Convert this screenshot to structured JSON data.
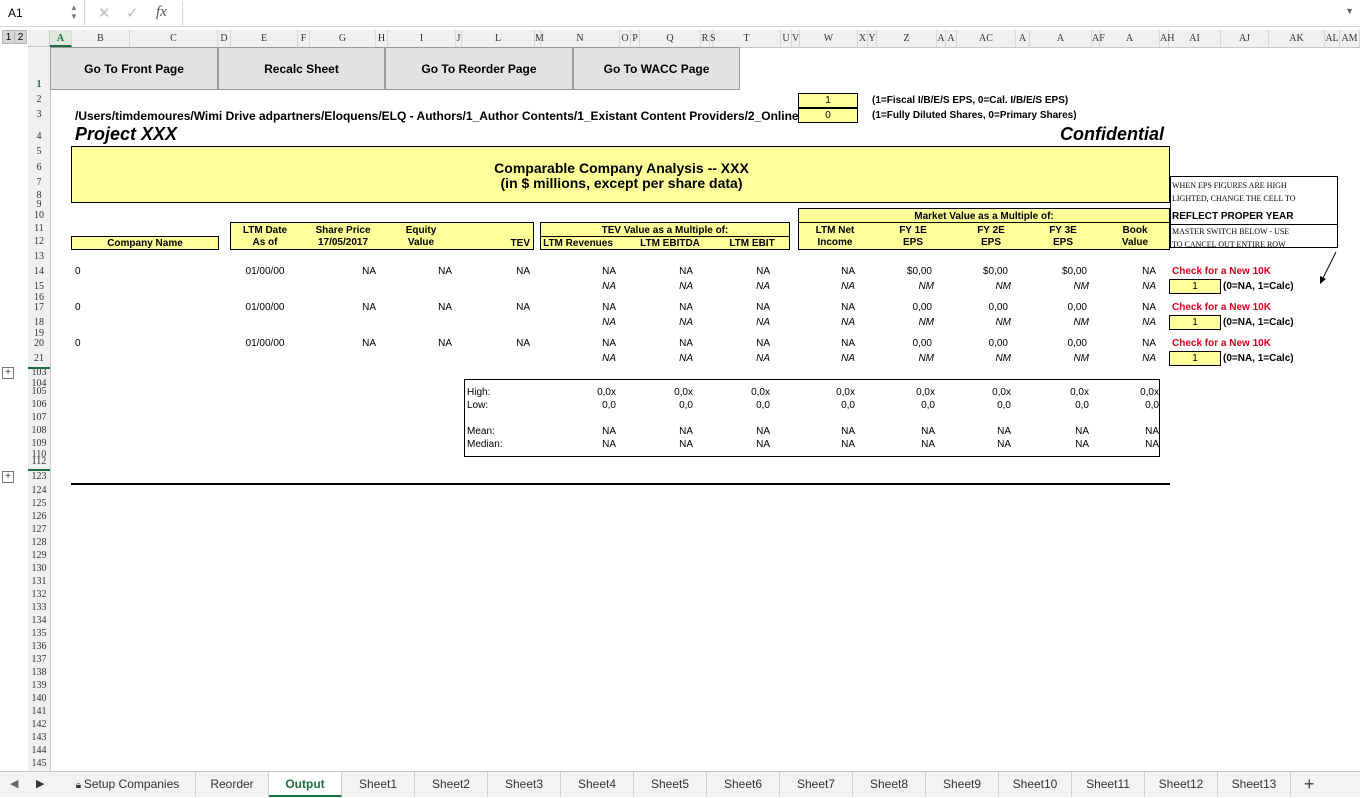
{
  "formula_bar": {
    "cell_ref": "A1",
    "formula_value": "",
    "fx_label": "fx"
  },
  "outline_levels": [
    "1",
    "2"
  ],
  "columns": [
    "A",
    "B",
    "C",
    "D",
    "E",
    "F",
    "G",
    "H",
    "I",
    "J",
    "L",
    "M",
    "N",
    "O",
    "P",
    "Q",
    "R",
    "S",
    "T",
    "U",
    "V",
    "W",
    "X",
    "Y",
    "Z",
    "A",
    "A",
    "AC",
    "A",
    "A",
    "AF",
    "A",
    "AH",
    "AI",
    "AJ",
    "AK",
    "AL",
    "AM"
  ],
  "rows": [
    "1",
    "2",
    "3",
    "4",
    "5",
    "6",
    "7",
    "8",
    "9",
    "10",
    "11",
    "12",
    "13",
    "14",
    "15",
    "16",
    "17",
    "18",
    "19",
    "20",
    "21",
    "103",
    "104",
    "105",
    "106",
    "107",
    "108",
    "109",
    "110",
    "112",
    "123",
    "124",
    "125",
    "126",
    "127",
    "128",
    "129",
    "130",
    "131",
    "132",
    "133",
    "134",
    "135",
    "136",
    "137",
    "138",
    "139",
    "140",
    "141",
    "142",
    "143",
    "144",
    "145"
  ],
  "buttons": {
    "front": "Go To Front Page",
    "recalc": "Recalc Sheet",
    "reorder": "Go To Reorder Page",
    "wacc": "Go To WACC Page"
  },
  "switches": {
    "eps_value": "1",
    "eps_note": "(1=Fiscal I/B/E/S EPS, 0=Cal. I/B/E/S EPS)",
    "shares_value": "0",
    "shares_note": "(1=Fully Diluted Shares, 0=Primary Shares)"
  },
  "path": "/Users/timdemoures/Wimi Drive adpartners/Eloquens/ELQ - Authors/1_Author Contents/1_Existant Content Providers/2_Online",
  "project": "Project XXX",
  "confidential": "Confidential",
  "title": {
    "line1": "Comparable Company Analysis -- XXX",
    "line2": "(in $ millions, except per share data)"
  },
  "notes": {
    "line1": "WHEN EPS FIGURES ARE HIGH",
    "line2": "LIGHTED, CHANGE THE CELL TO",
    "reflect": "REFLECT PROPER YEAR",
    "line3": "MASTER SWITCH BELOW - USE",
    "line4": "TO CANCEL OUT ENTIRE ROW"
  },
  "headers": {
    "company": "Company Name",
    "ltm_date": [
      "LTM Date",
      "As of"
    ],
    "share_price": [
      "Share Price",
      "17/05/2017"
    ],
    "equity": [
      "Equity",
      "Value"
    ],
    "tev": "TEV",
    "tev_group": "TEV Value as a Multiple of:",
    "ltm_revenues": "LTM Revenues",
    "ltm_ebitda": "LTM EBITDA",
    "ltm_ebit": "LTM EBIT",
    "mv_group": "Market Value as a Multiple of:",
    "ltm_net": [
      "LTM Net",
      "Income"
    ],
    "fy1": [
      "FY 1E",
      "EPS"
    ],
    "fy2": [
      "FY 2E",
      "EPS"
    ],
    "fy3": [
      "FY 3E",
      "EPS"
    ],
    "book": [
      "Book",
      "Value"
    ]
  },
  "companies": [
    {
      "name": "0",
      "date": "01/00/00",
      "price": "NA",
      "equity": "NA",
      "tev": "NA",
      "rev": "NA",
      "ebitda": "NA",
      "ebit": "NA",
      "net": "NA",
      "fy1": "$0,00",
      "fy2": "$0,00",
      "fy3": "$0,00",
      "book": "NA",
      "rev2": "NA",
      "ebitda2": "NA",
      "ebit2": "NA",
      "net2": "NA",
      "fy1b": "NM",
      "fy2b": "NM",
      "fy3b": "NM",
      "book2": "NA",
      "check": "Check for a New 10K",
      "switch": "1",
      "switch_note": "(0=NA, 1=Calc)"
    },
    {
      "name": "0",
      "date": "01/00/00",
      "price": "NA",
      "equity": "NA",
      "tev": "NA",
      "rev": "NA",
      "ebitda": "NA",
      "ebit": "NA",
      "net": "NA",
      "fy1": "0,00",
      "fy2": "0,00",
      "fy3": "0,00",
      "book": "NA",
      "rev2": "NA",
      "ebitda2": "NA",
      "ebit2": "NA",
      "net2": "NA",
      "fy1b": "NM",
      "fy2b": "NM",
      "fy3b": "NM",
      "book2": "NA",
      "check": "Check for a New 10K",
      "switch": "1",
      "switch_note": "(0=NA, 1=Calc)"
    },
    {
      "name": "0",
      "date": "01/00/00",
      "price": "NA",
      "equity": "NA",
      "tev": "NA",
      "rev": "NA",
      "ebitda": "NA",
      "ebit": "NA",
      "net": "NA",
      "fy1": "0,00",
      "fy2": "0,00",
      "fy3": "0,00",
      "book": "NA",
      "rev2": "NA",
      "ebitda2": "NA",
      "ebit2": "NA",
      "net2": "NA",
      "fy1b": "NM",
      "fy2b": "NM",
      "fy3b": "NM",
      "book2": "NA",
      "check": "Check for a New 10K",
      "switch": "1",
      "switch_note": "(0=NA, 1=Calc)"
    }
  ],
  "stats": {
    "labels": {
      "high": "High:",
      "low": "Low:",
      "mean": "Mean:",
      "median": "Median:"
    },
    "high": [
      "0,0x",
      "0,0x",
      "0,0x",
      "0,0x",
      "0,0x",
      "0,0x",
      "0,0x",
      "0,0x"
    ],
    "low": [
      "0,0",
      "0,0",
      "0,0",
      "0,0",
      "0,0",
      "0,0",
      "0,0",
      "0,0"
    ],
    "mean": [
      "NA",
      "NA",
      "NA",
      "NA",
      "NA",
      "NA",
      "NA",
      "NA"
    ],
    "median": [
      "NA",
      "NA",
      "NA",
      "NA",
      "NA",
      "NA",
      "NA",
      "NA"
    ]
  },
  "tabs": [
    "Setup Companies",
    "Reorder",
    "Output",
    "Sheet1",
    "Sheet2",
    "Sheet3",
    "Sheet4",
    "Sheet5",
    "Sheet6",
    "Sheet7",
    "Sheet8",
    "Sheet9",
    "Sheet10",
    "Sheet11",
    "Sheet12",
    "Sheet13"
  ],
  "active_tab": "Output",
  "colors": {
    "accent": "#1d6f42",
    "highlight": "#ffff99",
    "warn": "#e0001b"
  }
}
